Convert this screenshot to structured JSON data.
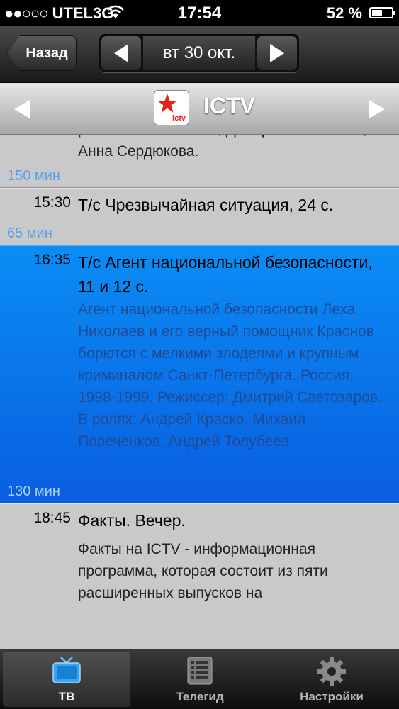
{
  "status_bar": {
    "carrier": "UTEL3G",
    "time": "17:54",
    "battery_percent": "52 %",
    "battery_level": 0.52
  },
  "nav": {
    "back_label": "Назад",
    "date_label": "вт 30 окт."
  },
  "channel": {
    "name": "ICTV",
    "logo_text": "ictv"
  },
  "programs": [
    {
      "time": "",
      "title": "",
      "description": "ролях: Павел Ильин, Дмитрий Белоногов, Анна Сердюкова.",
      "duration": "150 мин",
      "selected": false
    },
    {
      "time": "15:30",
      "title": "Т/с Чрезвычайная ситуация, 24 с.",
      "description": "",
      "duration": "65 мин",
      "selected": false
    },
    {
      "time": "16:35",
      "title": "Т/с Агент национальной безопасности, 11 и 12 с.",
      "description": "Агент национальной безопасности Леха Николаев и его верный помощник Краснов борются с мелкими злодеями и крупным криминалом Санкт-Петербурга. Россия, 1998-1999. Режиссер: Дмитрий Светозаров. В ролях: Андрей Краско, Михаил Пореченков, Андрей Толубеев.",
      "duration": "130 мин",
      "selected": true
    },
    {
      "time": "18:45",
      "title": "Факты. Вечер.",
      "description": "Факты на ICTV - информационная программа, которая состоит из пяти расширенных выпусков на",
      "duration": "",
      "selected": false
    }
  ],
  "tabs": [
    {
      "label": "ТВ",
      "icon": "tv-icon",
      "active": true
    },
    {
      "label": "Телегид",
      "icon": "list-icon",
      "active": false
    },
    {
      "label": "Настройки",
      "icon": "gear-icon",
      "active": false
    }
  ],
  "colors": {
    "selected_row": "#0a78f0",
    "duration_text": "#5aa0e8",
    "channel_logo_red": "#e2231a"
  }
}
